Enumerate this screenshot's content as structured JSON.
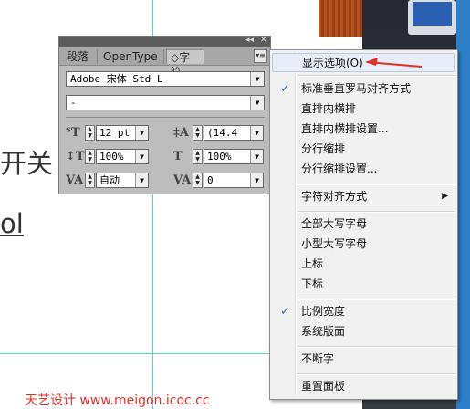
{
  "background": {
    "text_1": "开关",
    "text_2": "ol",
    "watermark": "天艺设计 www.meigon.icoc.cc"
  },
  "panel": {
    "tabs": [
      "段落",
      "OpenType",
      "◇字符"
    ],
    "font_family": "Adobe 宋体 Std L",
    "font_style": "-",
    "size": "12 pt",
    "leading": "(14.4",
    "vertical_scale": "100%",
    "horizontal_scale": "100%",
    "kerning": "自动",
    "tracking": "0",
    "menu_button_icon": "panel-menu-icon"
  },
  "menu": {
    "items": [
      {
        "label": "显示选项(O)",
        "highlighted": true
      },
      {
        "label": "标准垂直罗马对齐方式",
        "checked": true
      },
      {
        "label": "直排内横排"
      },
      {
        "label": "直排内横排设置..."
      },
      {
        "label": "分行缩排"
      },
      {
        "label": "分行缩排设置..."
      },
      {
        "label": "字符对齐方式",
        "submenu": true
      },
      {
        "label": "全部大写字母"
      },
      {
        "label": "小型大写字母"
      },
      {
        "label": "上标"
      },
      {
        "label": "下标"
      },
      {
        "label": "比例宽度",
        "checked": true
      },
      {
        "label": "系统版面"
      },
      {
        "label": "不断字"
      },
      {
        "label": "重置面板"
      }
    ],
    "check_glyph": "✓",
    "submenu_glyph": "▶"
  },
  "colors": {
    "annotation_arrow": "#e0302a",
    "guide": "#4fd3e6"
  }
}
